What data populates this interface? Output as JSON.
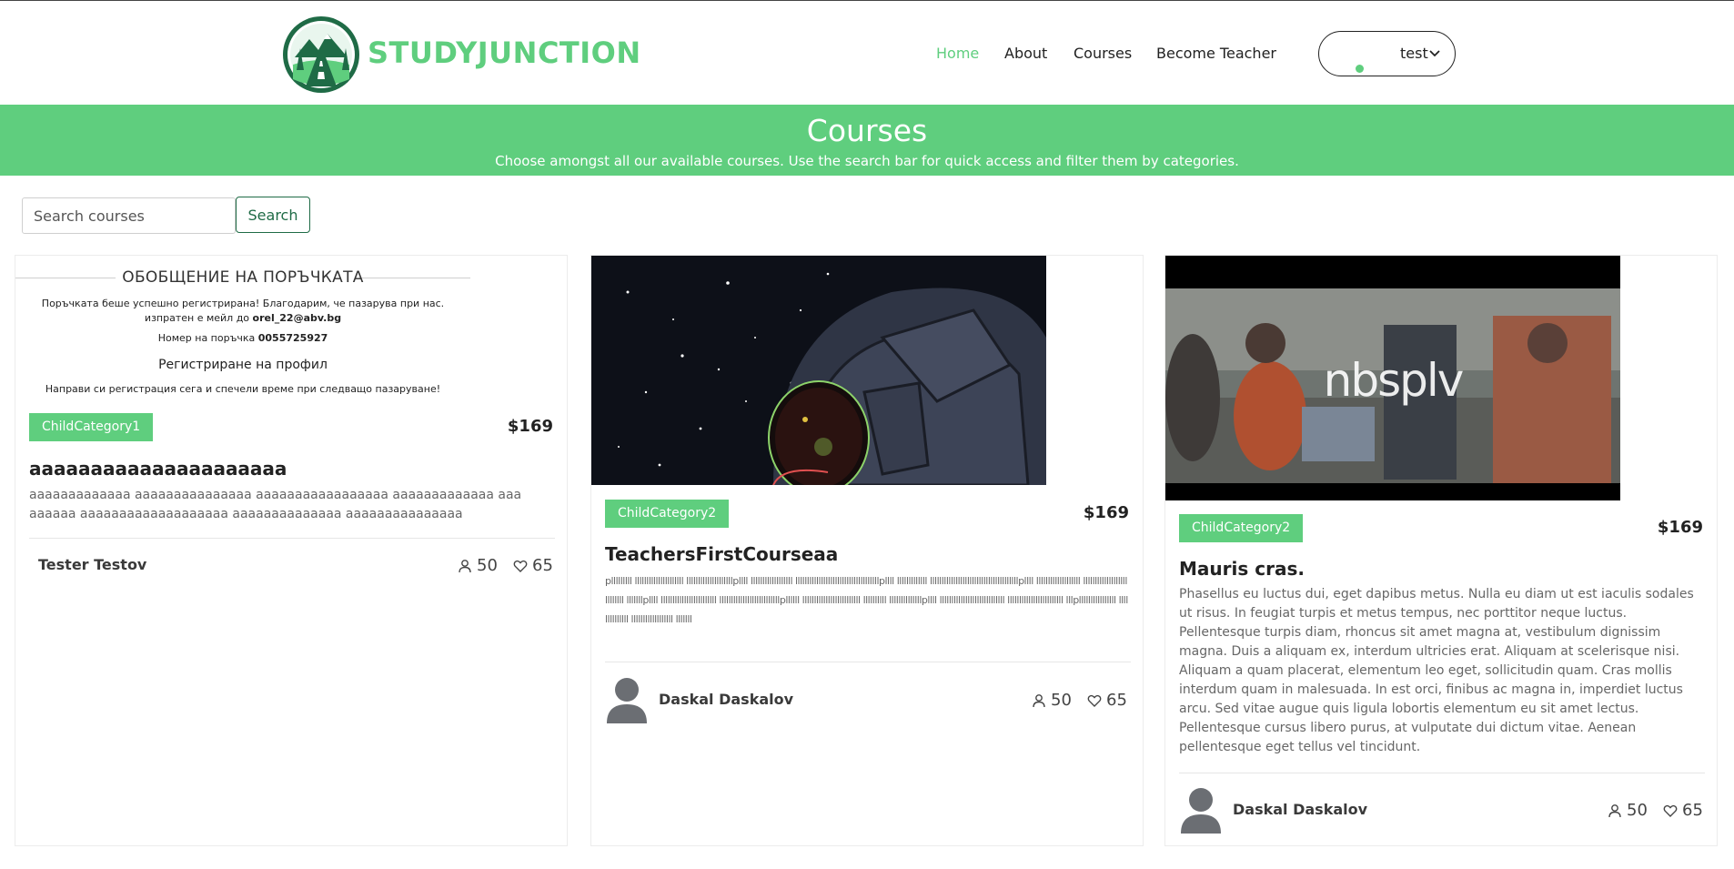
{
  "brand": {
    "name": "STUDYJUNCTION",
    "accent": "#5fce7e",
    "dark_green": "#1f6b46"
  },
  "nav": {
    "home": "Home",
    "about": "About",
    "courses": "Courses",
    "become_teacher": "Become Teacher"
  },
  "user": {
    "name": "test"
  },
  "banner": {
    "title": "Courses",
    "subtitle": "Choose amongst all our available courses. Use the search bar for quick access and filter them by categories."
  },
  "search": {
    "placeholder": "Search courses",
    "button": "Search"
  },
  "cards": [
    {
      "image": {
        "heading": "ОБОБЩЕНИЕ НА ПОРЪЧКАТА",
        "line1": "Поръчката беше успешно регистрирана! Благодарим, че пазарува при нас.",
        "line2_prefix": "изпратен е мейл до ",
        "email": "orel_22@abv.bg",
        "order_label": "Номер на поръчка ",
        "order_number": "0055725927",
        "register_heading": "Регистриране на профил",
        "register_text": "Направи си регистрация сега и спечели време при следващо пазаруване!"
      },
      "category": "ChildCategory1",
      "price": "$169",
      "title": "aaaaaaaaaaaaaaaaaaaaa",
      "description": "aaaaaaaaaaaaa aaaaaaaaaaaaaaa aaaaaaaaaaaaaaaaa aaaaaaaaaaaaa aaaaaaaaa aaaaaaaaaaaaaaaaaaa aaaaaaaaaaaaaa aaaaaaaaaaaaaaa",
      "author": "Tester Testov",
      "students": "50",
      "likes": "65"
    },
    {
      "image_icon": "astronaut-illustration",
      "category": "ChildCategory2",
      "price": "$169",
      "title": "TeachersFirstCourseaa",
      "description": "plllllllll lllllllllllllllllllll llllllllllllllllllllpllll llllllllllllllllll llllllllllllllllllllllllllllllllllllpllll lllllllllllll llllllllllllllllllllllllllllllllllllllpllll lllllllllllllllllll lllllllllllllllllllllllllll lllllllpllll llllllllllllllllllllllll llllllllllllllllllllllllllpllllll lllllllllllllllllllllllll llllllllll llllllllllllllpllll llllllllllllllllllllllllllll llllllllllllllllllllllll lllpllllllllllllllll llllllllllllll llllllllllllllllll lllllll",
      "author": "Daskal Daskalov",
      "students": "50",
      "likes": "65"
    },
    {
      "image": {
        "overlay_text": "nbsplv"
      },
      "category": "ChildCategory2",
      "price": "$169",
      "title": "Mauris cras.",
      "description": "Phasellus eu luctus dui, eget dapibus metus. Nulla eu diam ut est iaculis sodales ut risus. In feugiat turpis et metus tempus, nec porttitor neque luctus. Pellentesque turpis diam, rhoncus sit amet magna at, vestibulum dignissim magna. Duis a aliquam ex, interdum ultricies erat. Aliquam at scelerisque nisi. Aliquam a quam placerat, elementum leo eget, sollicitudin quam. Cras mollis interdum quam in malesuada. In est orci, finibus ac magna in, imperdiet luctus arcu. Sed vitae augue quis ligula lobortis elementum eu sit amet lectus. Pellentesque cursus libero purus, at vulputate dui dictum vitae. Aenean pellentesque eget tellus vel tincidunt.",
      "author": "Daskal Daskalov",
      "students": "50",
      "likes": "65"
    }
  ]
}
